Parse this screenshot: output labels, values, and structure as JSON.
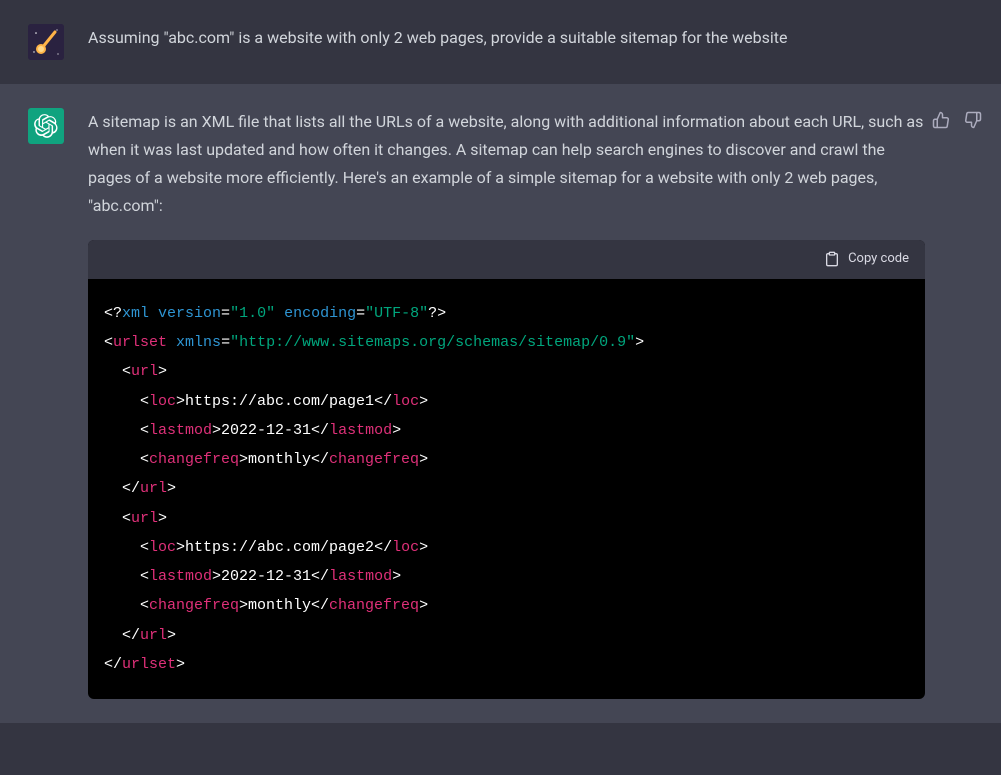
{
  "user": {
    "message": "Assuming \"abc.com\" is a website with only 2 web pages, provide a suitable sitemap for the website"
  },
  "assistant": {
    "message": "A sitemap is an XML file that lists all the URLs of a website, along with additional information about each URL, such as when it was last updated and how often it changes. A sitemap can help search engines to discover and crawl the pages of a website more efficiently. Here's an example of a simple sitemap for a website with only 2 web pages, \"abc.com\":",
    "copy_label": "Copy code",
    "code": {
      "l01": {
        "a": "<?",
        "b": "xml version",
        "c": "=",
        "d": "\"1.0\"",
        "e": " encoding",
        "f": "=",
        "g": "\"UTF-8\"",
        "h": "?>"
      },
      "l02": {
        "a": "<",
        "b": "urlset",
        "c": " ",
        "d": "xmlns",
        "e": "=",
        "f": "\"http://www.sitemaps.org/schemas/sitemap/0.9\"",
        "g": ">"
      },
      "l03": {
        "a": "  <",
        "b": "url",
        "c": ">"
      },
      "l04": {
        "a": "    <",
        "b": "loc",
        "c": ">https://abc.com/page1</",
        "d": "loc",
        "e": ">"
      },
      "l05": {
        "a": "    <",
        "b": "lastmod",
        "c": ">2022-12-31</",
        "d": "lastmod",
        "e": ">"
      },
      "l06": {
        "a": "    <",
        "b": "changefreq",
        "c": ">monthly</",
        "d": "changefreq",
        "e": ">"
      },
      "l07": {
        "a": "  </",
        "b": "url",
        "c": ">"
      },
      "l08": {
        "a": "  <",
        "b": "url",
        "c": ">"
      },
      "l09": {
        "a": "    <",
        "b": "loc",
        "c": ">https://abc.com/page2</",
        "d": "loc",
        "e": ">"
      },
      "l10": {
        "a": "    <",
        "b": "lastmod",
        "c": ">2022-12-31</",
        "d": "lastmod",
        "e": ">"
      },
      "l11": {
        "a": "    <",
        "b": "changefreq",
        "c": ">monthly</",
        "d": "changefreq",
        "e": ">"
      },
      "l12": {
        "a": "  </",
        "b": "url",
        "c": ">"
      },
      "l13": {
        "a": "</",
        "b": "urlset",
        "c": ">"
      }
    }
  }
}
